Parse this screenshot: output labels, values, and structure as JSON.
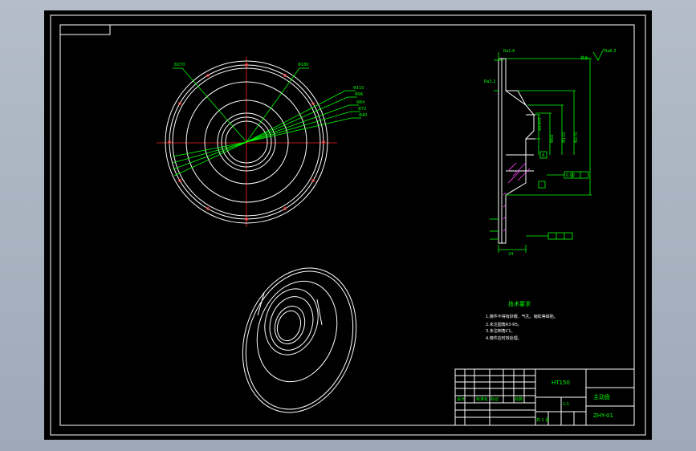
{
  "drawing": {
    "title_block": {
      "part_name": "主动盘",
      "material": "HT150",
      "drawing_no": "ZHY-01",
      "cells_row1": [
        "设计",
        "标准化",
        "标记",
        "处数"
      ],
      "scale": "1:1",
      "sheet": "共 1 张"
    },
    "tech_requirements": {
      "title": "技术要求",
      "items": [
        "1.铸件不得有砂眼、气孔、缩松等缺陷。",
        "2.未注圆角R3-R5。",
        "3.未注倒角C1。",
        "4.铸件应时效处理。"
      ]
    },
    "roughness_note": "其余",
    "roughness_value": "Ra6.3",
    "front_view_labels": [
      "Φ270",
      "Φ180",
      "Φ110",
      "Φ96",
      "Φ84",
      "Φ72",
      "Φ40",
      "Φ30"
    ],
    "side_view_labels": [
      "Ra1.6",
      "Ra3.2",
      "Φ24H7",
      "Φ60",
      "Φ110",
      "Φ270",
      "0.02",
      "A",
      "12",
      "18",
      "24"
    ]
  }
}
